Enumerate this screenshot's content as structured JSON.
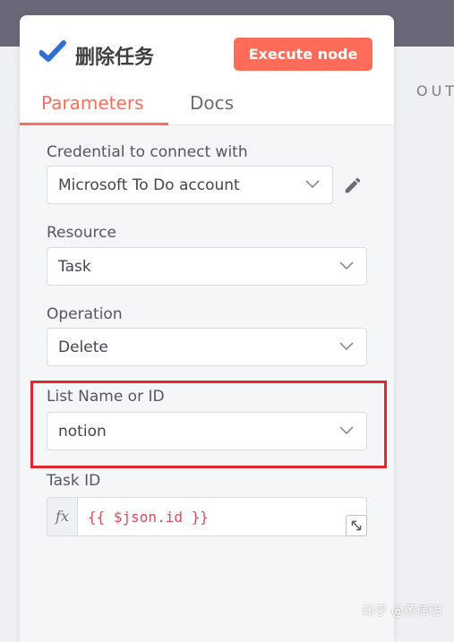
{
  "node": {
    "title": "删除任务",
    "execute_label": "Execute node"
  },
  "tabs": [
    {
      "label": "Parameters",
      "active": true
    },
    {
      "label": "Docs",
      "active": false
    }
  ],
  "background": {
    "output_label": "OUT"
  },
  "fields": {
    "credential": {
      "label": "Credential to connect with",
      "value": "Microsoft To Do account"
    },
    "resource": {
      "label": "Resource",
      "value": "Task"
    },
    "operation": {
      "label": "Operation",
      "value": "Delete"
    },
    "list": {
      "label": "List Name or ID",
      "value": "notion"
    },
    "task_id": {
      "label": "Task ID",
      "fx": "fx",
      "value": "{{ $json.id }}"
    }
  },
  "watermark": "知乎 @黄伟明",
  "colors": {
    "accent": "#ff6d5a",
    "check": "#2f6fd6",
    "highlight_border": "#e0262e",
    "expression_text": "#e0495a"
  },
  "icons": [
    "check-icon",
    "gear-icon",
    "pencil-icon",
    "chevron-down-icon",
    "expand-icon"
  ]
}
